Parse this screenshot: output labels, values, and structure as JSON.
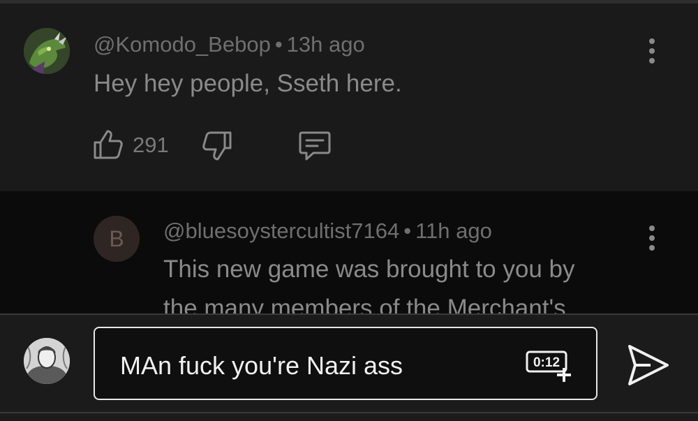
{
  "comment": {
    "handle": "@Komodo_Bebop",
    "separator": "•",
    "time": "13h ago",
    "text": "Hey hey people, Sseth here.",
    "like_count": "291",
    "icons": {
      "avatar": "komodo-avatar",
      "like": "thumbs-up-icon",
      "dislike": "thumbs-down-icon",
      "reply": "reply-comment-icon",
      "menu": "more-vert-icon"
    }
  },
  "reply": {
    "avatar_letter": "B",
    "handle": "@bluesoystercultist7164",
    "separator": "•",
    "time": "11h ago",
    "text_line1": "This new game was brought to you by",
    "text_line2": "the many members of the Merchant's",
    "icons": {
      "menu": "more-vert-icon"
    }
  },
  "composer": {
    "input_value": "MAn fuck you're Nazi ass",
    "timestamp_badge": "0:12",
    "icons": {
      "user_avatar": "user-avatar",
      "timestamp": "add-timestamp-icon",
      "send": "send-icon"
    }
  },
  "colors": {
    "comment_bg": "#1a1a1a",
    "reply_bg": "#0b0b0b",
    "composer_bg": "#1b1b1b",
    "input_border": "#e8e8e8",
    "muted_text": "#6f6f6f"
  }
}
